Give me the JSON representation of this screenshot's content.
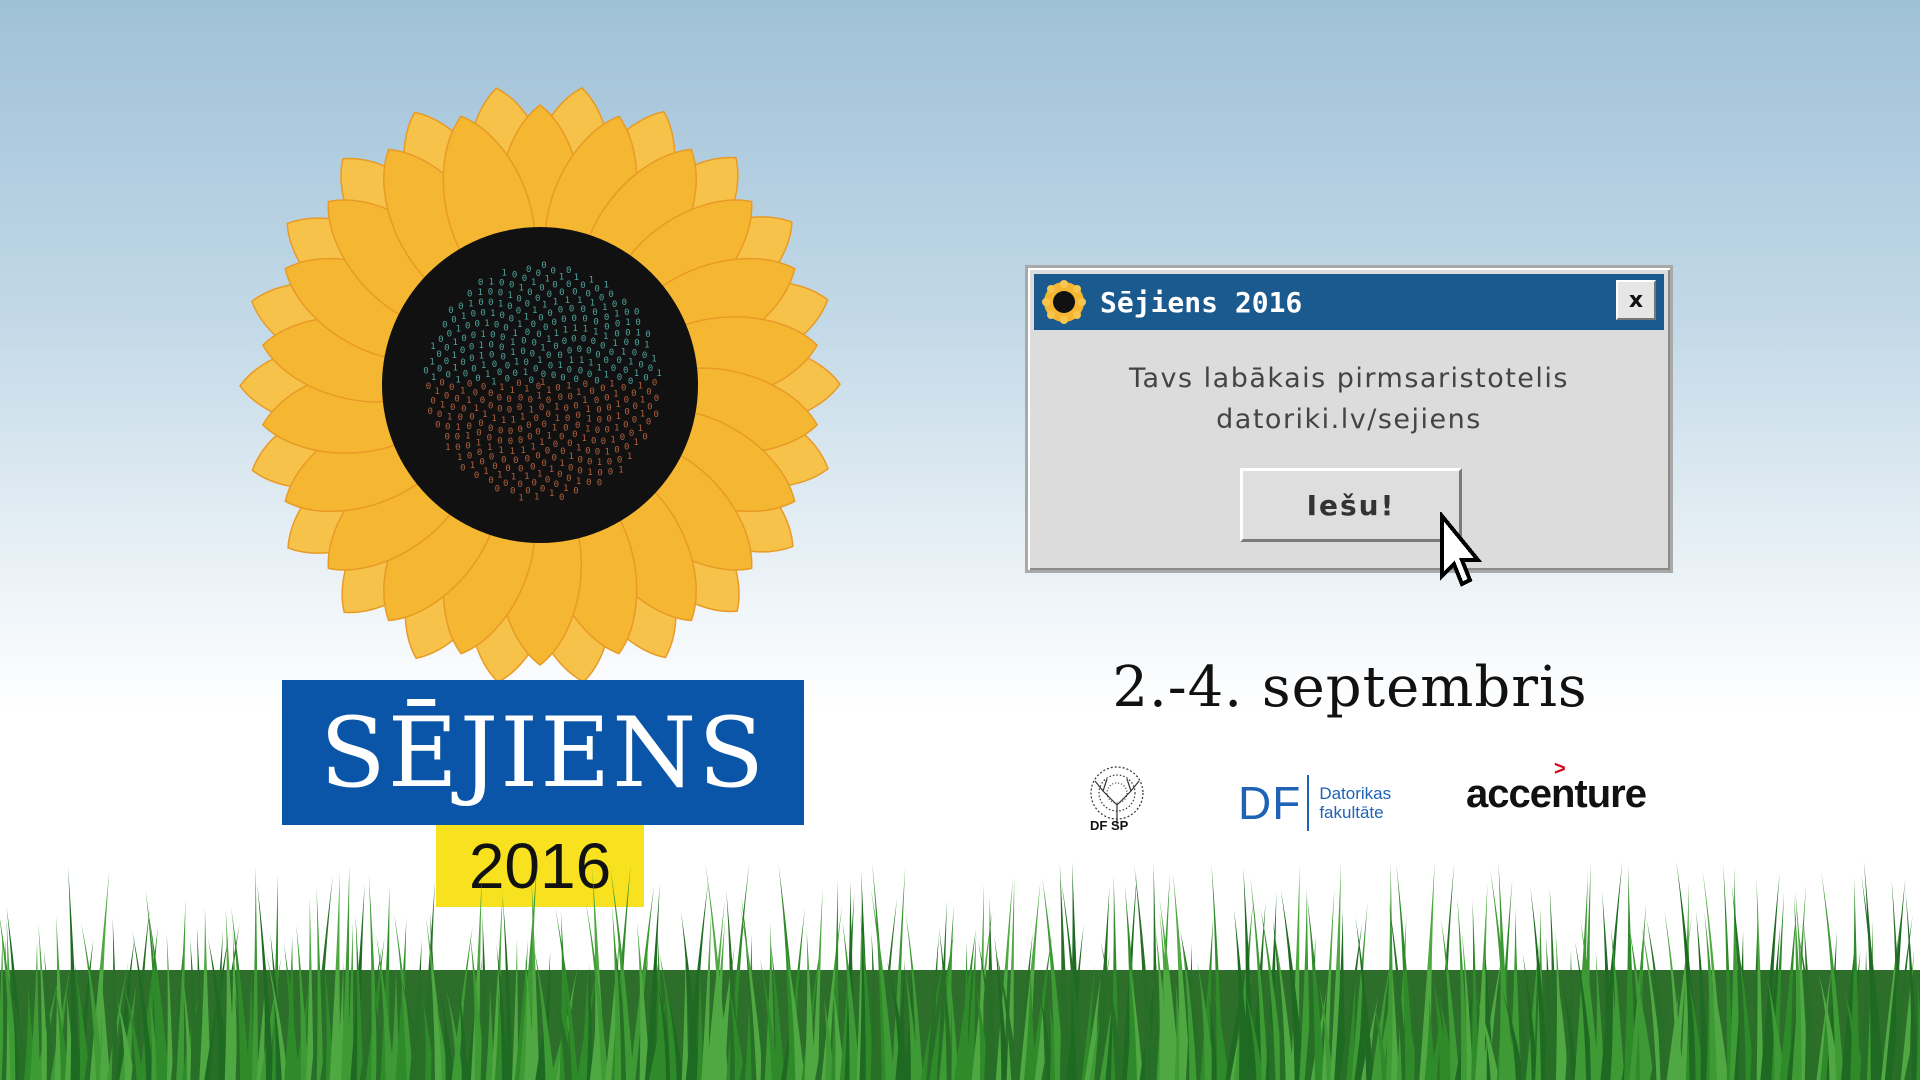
{
  "poster": {
    "title": "SĒJIENS",
    "year": "2016",
    "date": "2.-4. septembris"
  },
  "dialog": {
    "title": "Sējiens 2016",
    "close_label": "x",
    "message_line1": "Tavs labākais pirmsaristotelis",
    "message_line2": "datoriki.lv/sejiens",
    "button_label": "Iešu!"
  },
  "sponsors": {
    "dfsp": "DF SP",
    "df_mark": "DF",
    "df_line1": "Datorikas",
    "df_line2": "fakultāte",
    "accenture": "accenture"
  },
  "colors": {
    "title_blue": "#0a55a8",
    "year_yellow": "#f8e21f",
    "titlebar_blue": "#1b5a8e",
    "petal_orange": "#f5b731",
    "grass_green": "#2f8a2a"
  },
  "icons": [
    "sunflower-icon",
    "cursor-pointer-icon",
    "tree-logo-icon"
  ]
}
